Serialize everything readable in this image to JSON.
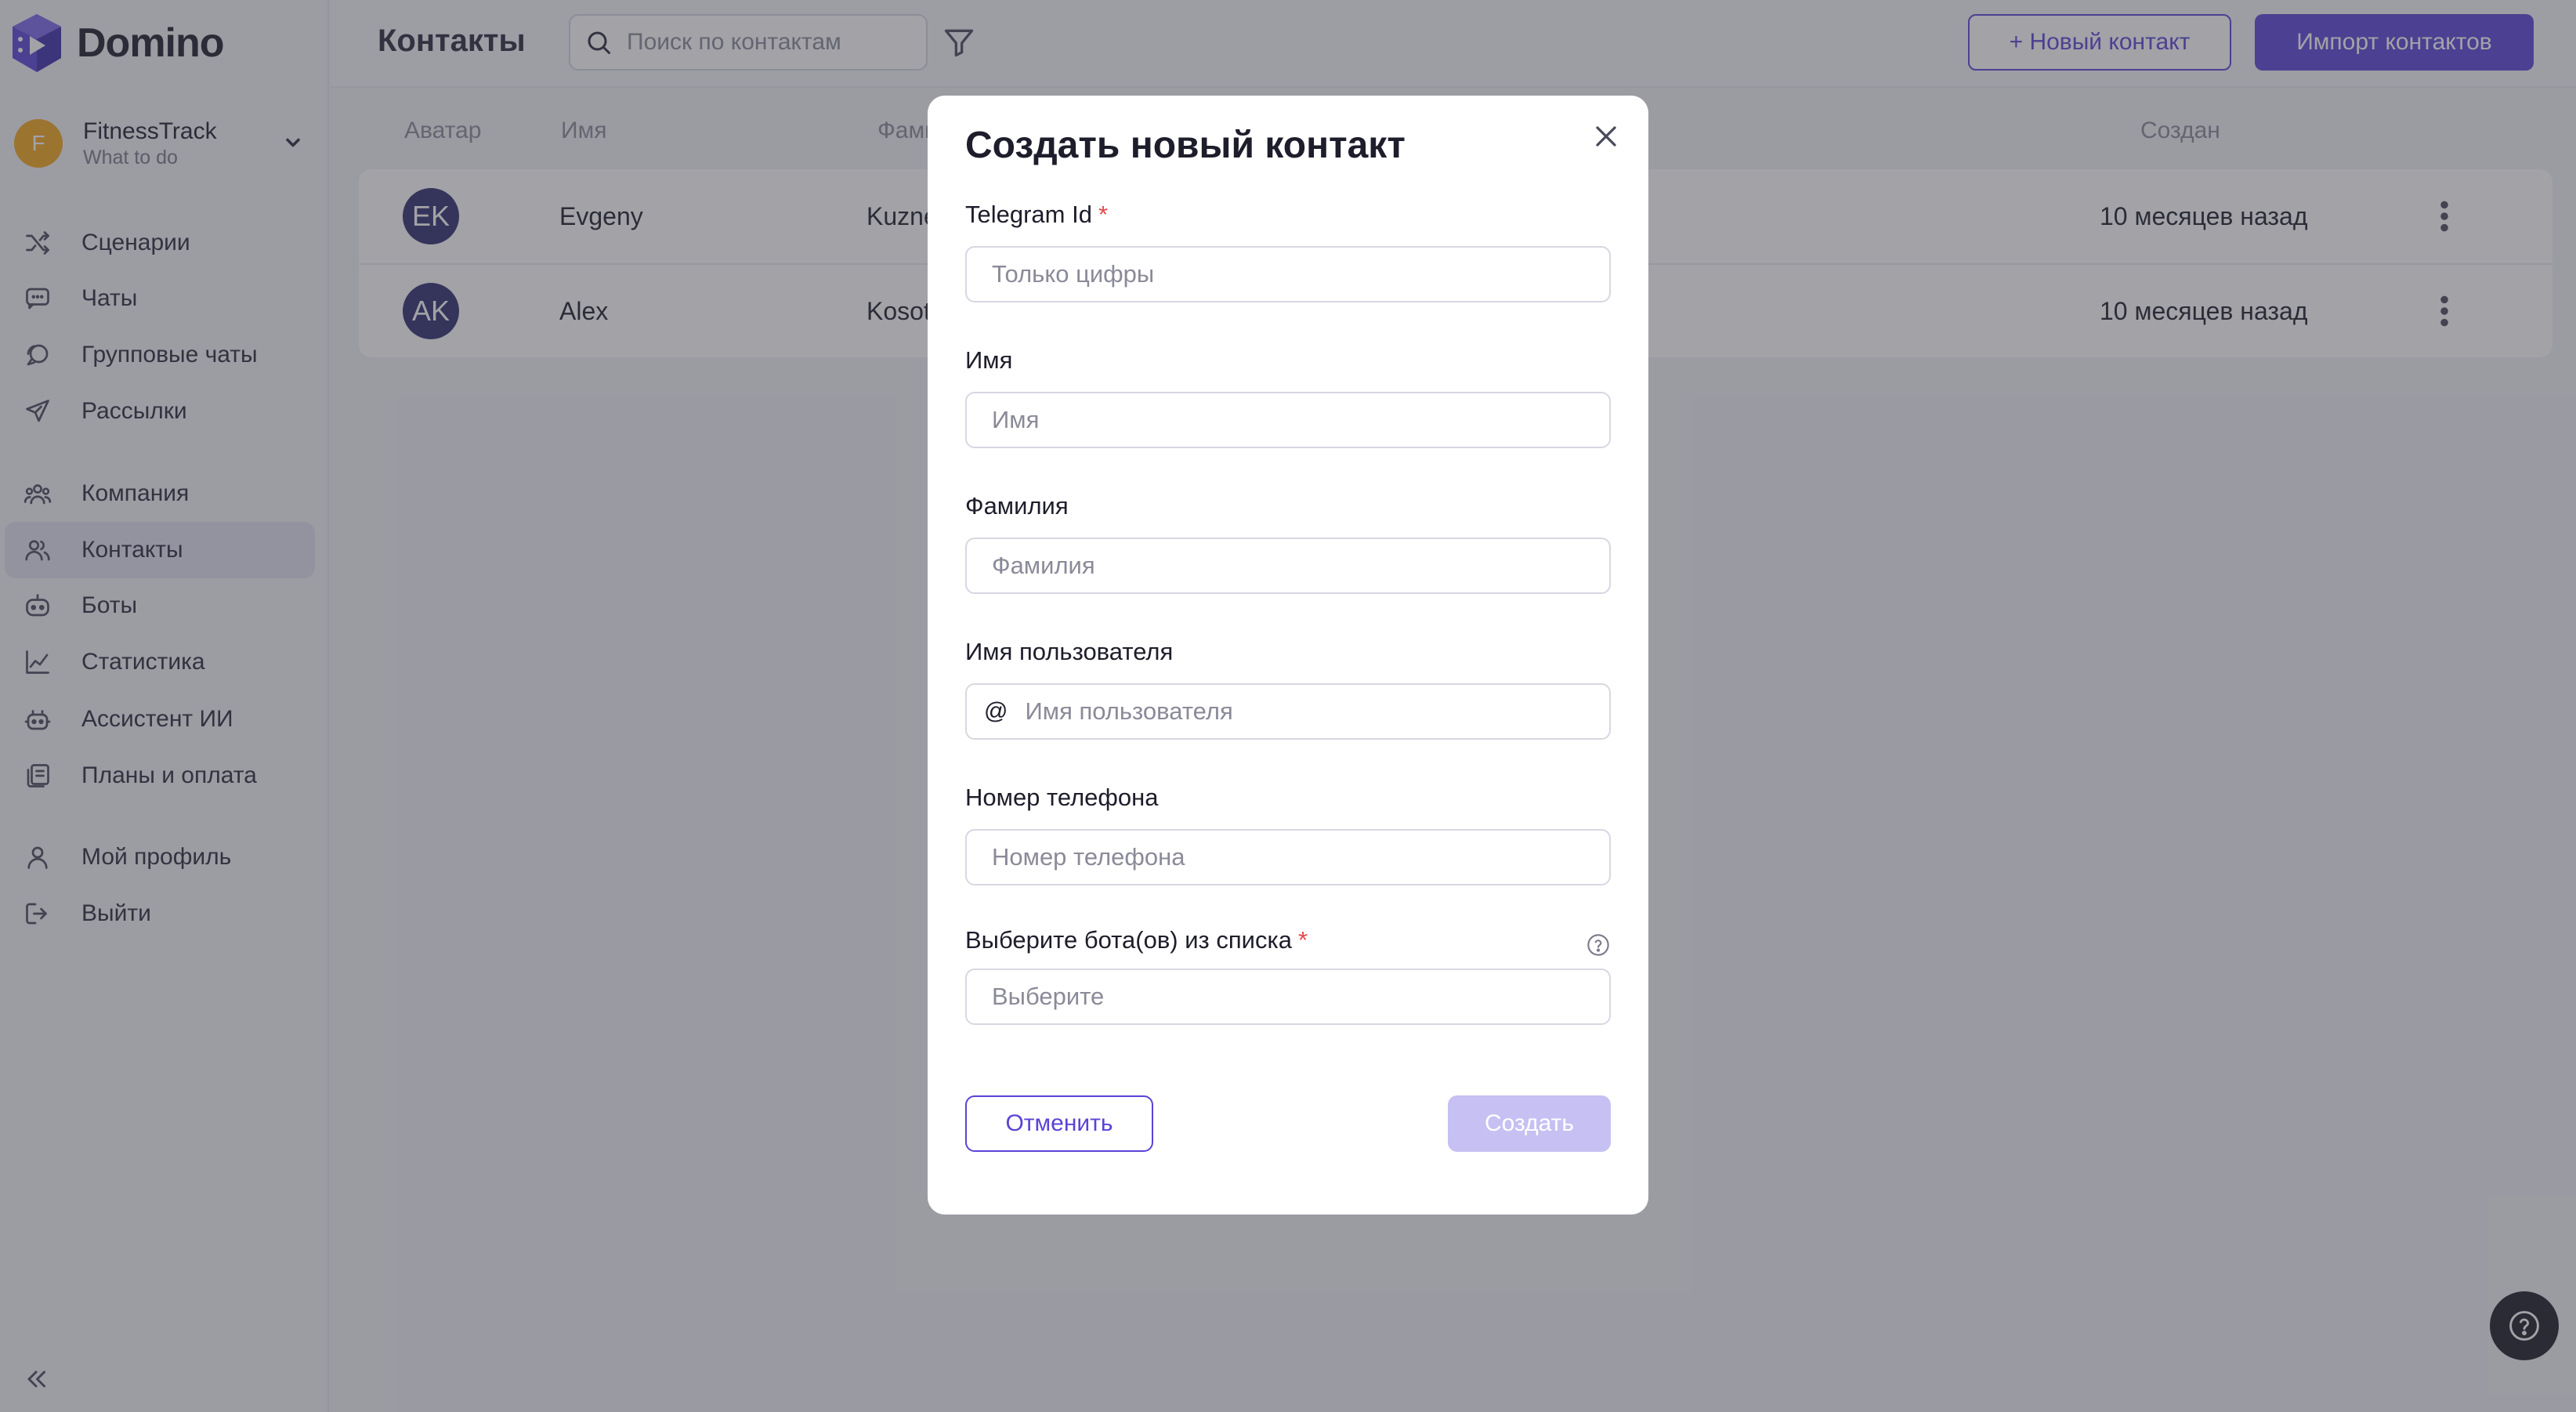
{
  "app": {
    "name": "Domino"
  },
  "account": {
    "initial": "F",
    "name": "FitnessTrack",
    "subtitle": "What to do"
  },
  "sidebar": {
    "items": [
      {
        "label": "Сценарии",
        "icon": "shuffle-icon"
      },
      {
        "label": "Чаты",
        "icon": "chat-icon"
      },
      {
        "label": "Групповые чаты",
        "icon": "group-chat-icon"
      },
      {
        "label": "Рассылки",
        "icon": "send-icon"
      },
      {
        "label": "Компания",
        "icon": "company-icon"
      },
      {
        "label": "Контакты",
        "icon": "contacts-icon",
        "active": true
      },
      {
        "label": "Боты",
        "icon": "bot-icon"
      },
      {
        "label": "Статистика",
        "icon": "chart-icon"
      },
      {
        "label": "Ассистент ИИ",
        "icon": "ai-assistant-icon"
      },
      {
        "label": "Планы и оплата",
        "icon": "billing-icon"
      },
      {
        "label": "Мой профиль",
        "icon": "profile-icon"
      },
      {
        "label": "Выйти",
        "icon": "logout-icon"
      }
    ]
  },
  "header": {
    "title": "Контакты",
    "search_placeholder": "Поиск по контактам",
    "new_contact_label": "+ Новый контакт",
    "import_label": "Импорт контактов"
  },
  "table": {
    "columns": {
      "avatar": "Аватар",
      "first_name": "Имя",
      "last_name": "Фами",
      "created": "Создан"
    },
    "rows": [
      {
        "initials": "EK",
        "first_name": "Evgeny",
        "last_name": "Kuzne",
        "created": "10 месяцев назад"
      },
      {
        "initials": "AK",
        "first_name": "Alex",
        "last_name": "Kosot",
        "created": "10 месяцев назад"
      }
    ]
  },
  "modal": {
    "title": "Создать новый контакт",
    "fields": {
      "telegram_id": {
        "label": "Telegram Id",
        "required_mark": "*",
        "placeholder": "Только цифры",
        "value": ""
      },
      "first_name": {
        "label": "Имя",
        "placeholder": "Имя",
        "value": ""
      },
      "last_name": {
        "label": "Фамилия",
        "placeholder": "Фамилия",
        "value": ""
      },
      "username": {
        "label": "Имя пользователя",
        "prefix": "@",
        "placeholder": "Имя пользователя",
        "value": ""
      },
      "phone": {
        "label": "Номер телефона",
        "placeholder": "Номер телефона",
        "value": ""
      },
      "bots": {
        "label": "Выберите бота(ов) из списка",
        "required_mark": "*",
        "placeholder": "Выберите",
        "value": ""
      }
    },
    "cancel_label": "Отменить",
    "create_label": "Создать"
  },
  "colors": {
    "accent": "#5a43d6",
    "accent_disabled": "#c6c0f3",
    "required": "#e5484d",
    "avatar_dark": "#2e2d6d",
    "account_avatar": "#f2a71b"
  }
}
